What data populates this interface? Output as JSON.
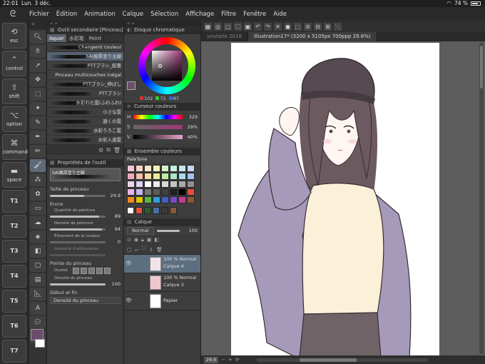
{
  "status": {
    "time": "22:01",
    "date": "Lun. 3 déc.",
    "battery": "74 %"
  },
  "menu": [
    "Fichier",
    "Édition",
    "Animation",
    "Calque",
    "Sélection",
    "Affichage",
    "Filtre",
    "Fenêtre",
    "Aide"
  ],
  "edgekeys": [
    {
      "glyph": "⟲",
      "label": "esc"
    },
    {
      "glyph": "⌃",
      "label": "control"
    },
    {
      "glyph": "⇧",
      "label": "shift"
    },
    {
      "glyph": "⌥",
      "label": "option"
    },
    {
      "glyph": "⌘",
      "label": "command"
    },
    {
      "glyph": "▬",
      "label": "space"
    }
  ],
  "tkeys": [
    "T1",
    "T2",
    "T3",
    "T4",
    "T5",
    "T6",
    "T7"
  ],
  "subtool": {
    "header": "Outil secondaire [Pinceau]",
    "tabs": [
      "Aquar",
      "水彩笔",
      "Peint"
    ],
    "brushes": [
      "Changemt couleur",
      "SAI風厚塗り主線",
      "PTTブラシ_鉛筆",
      "Pinceau multicouches inégal",
      "PTTブラシ_伸ばし",
      "PTTブラシ",
      "水彩わた雲(ふわふわ)",
      "小さな雲",
      "遠くの雲",
      "水彩うろこ雲",
      "水彩入道雲"
    ]
  },
  "toolprops": {
    "header": "Propriétés de l'outil",
    "brush_name": "SAI風厚塗り主線",
    "size_label": "Taille de pinceau",
    "size_value": "24.9",
    "encre_label": "Encre",
    "quantite_label": "Quantité de peinture",
    "quantite_value": "89",
    "densite_label": "Densité de peinture",
    "densite_value": "94",
    "etirement_label": "Étirement de la couleur",
    "etirement_value": "0",
    "mesure_label": "Intensité d'atténuation",
    "pointe_label": "Pointe du pinceau",
    "durete_label": "Dureté",
    "densite_pinceau_label": "Densité du pinceau",
    "densite_pinceau_value": "100",
    "debut_label": "Début et fin",
    "debut_value": "Densité du pinceau"
  },
  "colorwheel": {
    "header": "Disque chromatique",
    "r": "102",
    "g": "72",
    "b": "87"
  },
  "colorslider": {
    "header": "Curseur couleurs",
    "h": "329",
    "s": "29%",
    "v": "40%"
  },
  "colorset": {
    "header": "Ensemble couleurs",
    "name": "PaleTone",
    "swatches": [
      "#f4c7d0",
      "#f6d7c5",
      "#f7e6c3",
      "#f2f1c0",
      "#d7f0c7",
      "#c8eedc",
      "#c7e6ee",
      "#c8d6f0",
      "#f1a9bc",
      "#f4c0a4",
      "#f7dba2",
      "#eeec9e",
      "#c1eca6",
      "#a8e8c9",
      "#a6dbeb",
      "#a8c0ee",
      "#e9d4ee",
      "#dcd3f2",
      "#ffffff",
      "#ececec",
      "#d9d9d9",
      "#c4c4c4",
      "#aaaaaa",
      "#8f8f8f",
      "#e9b5e8",
      "#c9b7f0",
      "#757575",
      "#5c5c5c",
      "#404040",
      "#202020",
      "#000000",
      "#e94f3a",
      "#f08a1a",
      "#e3c200",
      "#52b848",
      "#2f9fd8",
      "#3c5fc8",
      "#7b4bc2",
      "#c43c8d",
      "#8a5a3c"
    ],
    "recent": [
      "#ffffff",
      "#e94f3a",
      "#2c5f2e",
      "#4a6fa5",
      "#3a3a3a",
      "#8a5a3c"
    ]
  },
  "layers": {
    "header": "Calque",
    "blend": "Normal",
    "opacity": "100",
    "items": [
      {
        "opacity": "100 % Normal",
        "name": "Calque 4",
        "active": true,
        "thumb": "#f3e2e6"
      },
      {
        "opacity": "100 % Normal",
        "name": "Calque 3",
        "active": false,
        "thumb": "#f1c7cf"
      },
      {
        "opacity": "",
        "name": "Papier",
        "active": false,
        "thumb": "#ffffff"
      }
    ]
  },
  "canvas": {
    "tabs": [
      "youtaite 2018",
      "Illustration17* (3200 x 5105px 700ppp 29.6%)"
    ],
    "zoom": "29.6"
  }
}
